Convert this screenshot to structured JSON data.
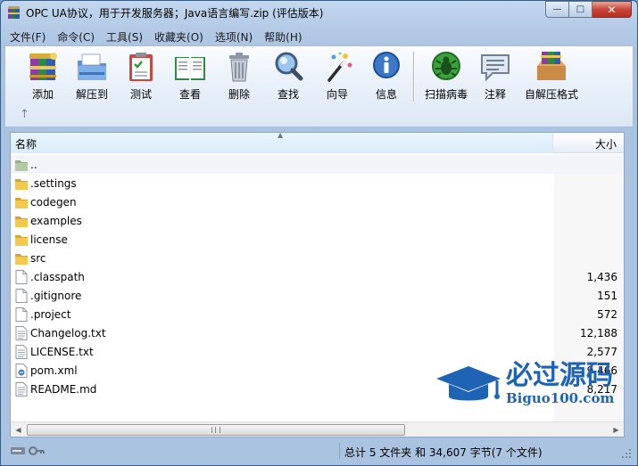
{
  "window": {
    "title": "OPC UA协议，用于开发服务器；Java语言编写.zip (评估版本)",
    "buttons": {
      "minimize": "—",
      "maximize": "□",
      "close": "✕"
    }
  },
  "menu": [
    "文件(F)",
    "命令(C)",
    "工具(S)",
    "收藏夹(O)",
    "选项(N)",
    "帮助(H)"
  ],
  "toolbar": [
    {
      "label": "添加",
      "icon": "add-archive-icon"
    },
    {
      "label": "解压到",
      "icon": "extract-to-icon"
    },
    {
      "label": "测试",
      "icon": "test-clipboard-icon"
    },
    {
      "label": "查看",
      "icon": "view-book-icon"
    },
    {
      "label": "删除",
      "icon": "delete-trash-icon"
    },
    {
      "label": "查找",
      "icon": "find-magnifier-icon"
    },
    {
      "label": "向导",
      "icon": "wizard-wand-icon"
    },
    {
      "label": "信息",
      "icon": "info-icon"
    },
    {
      "label": "扫描病毒",
      "icon": "virus-scan-icon"
    },
    {
      "label": "注释",
      "icon": "comment-icon"
    },
    {
      "label": "自解压格式",
      "icon": "sfx-archive-icon"
    }
  ],
  "list": {
    "columns": {
      "name": "名称",
      "size": "大小"
    },
    "rows": [
      {
        "name": "..",
        "size": "",
        "type": "up"
      },
      {
        "name": ".settings",
        "size": "",
        "type": "folder"
      },
      {
        "name": "codegen",
        "size": "",
        "type": "folder"
      },
      {
        "name": "examples",
        "size": "",
        "type": "folder"
      },
      {
        "name": "license",
        "size": "",
        "type": "folder"
      },
      {
        "name": "src",
        "size": "",
        "type": "folder"
      },
      {
        "name": ".classpath",
        "size": "1,436",
        "type": "file"
      },
      {
        "name": ".gitignore",
        "size": "151",
        "type": "file"
      },
      {
        "name": ".project",
        "size": "572",
        "type": "file"
      },
      {
        "name": "Changelog.txt",
        "size": "12,188",
        "type": "text"
      },
      {
        "name": "LICENSE.txt",
        "size": "2,577",
        "type": "text"
      },
      {
        "name": "pom.xml",
        "size": "9,466",
        "type": "xml"
      },
      {
        "name": "README.md",
        "size": "8,217",
        "type": "text"
      }
    ]
  },
  "status": {
    "text": "总计 5 文件夹 和 34,607 字节(7 个文件)"
  },
  "watermark": {
    "title": "必过源码",
    "subtitle": "Biguo100.com"
  },
  "colors": {
    "accent": "#1f63b4",
    "titlebar": "#c3d7ee",
    "selection_header": "#d9ecfa"
  }
}
